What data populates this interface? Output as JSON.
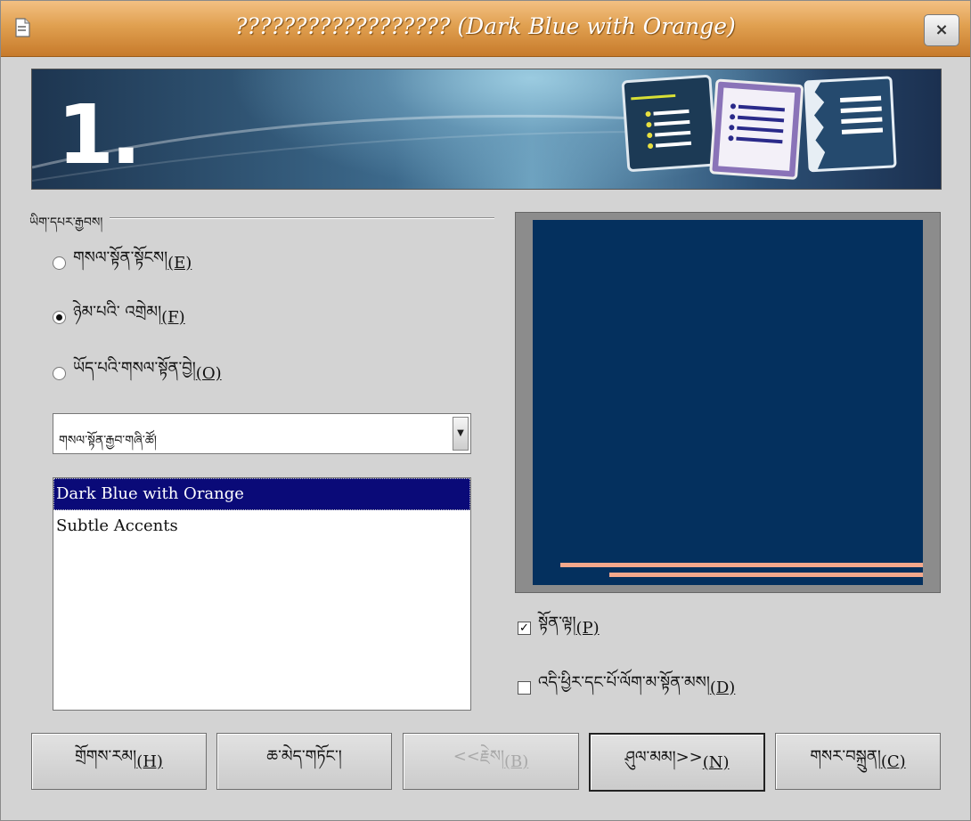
{
  "window": {
    "title": "?????????????????? (Dark Blue with Orange)",
    "close_label": "×"
  },
  "banner": {
    "step_number": "1."
  },
  "group": {
    "label": "ཡིག་དཔར་རྒྱབས།"
  },
  "radios": [
    {
      "label": "གསལ་སྟོན་སྟོངས།",
      "mnemonic": "(E)",
      "checked": false
    },
    {
      "label": "ཉེམ་པའི་ འགྲེམ།",
      "mnemonic": "(F)",
      "checked": true
    },
    {
      "label": "ཡོད་པའི་གསལ་སྟོན་བྱེ།",
      "mnemonic": "(O)",
      "checked": false
    }
  ],
  "template_select": {
    "value": "གསལ་སྟོན་རྒྱབ་གཞི་ཚོ།"
  },
  "design_list": {
    "items": [
      "Dark Blue with Orange",
      "Subtle Accents"
    ],
    "selected_index": 0
  },
  "preview": {
    "background_color": "#04305e",
    "accent_color": "#f4a88c"
  },
  "checkboxes": [
    {
      "label": "སྟོན་ལྟ།",
      "mnemonic": "(P)",
      "checked": true
    },
    {
      "label": "འདི་ཕྱིར་དང་པོ་ལོག་མ་སྟོན་མས།",
      "mnemonic": "(D)",
      "checked": false
    }
  ],
  "buttons": {
    "help": {
      "label": "གྲོགས་རམ།",
      "mnemonic": "(H)"
    },
    "cancel": {
      "label": "ཆ་མེད་གཏོང་།"
    },
    "back": {
      "label": "<<རྗེས།",
      "mnemonic": "(B)"
    },
    "next": {
      "label": "ཤུལ་མམ།>>",
      "mnemonic": "(N)"
    },
    "create": {
      "label": "གསར་བསྐྲུན།",
      "mnemonic": "(C)"
    }
  },
  "colors": {
    "titlebar": "#e0a050",
    "selection": "#0a0a78"
  }
}
